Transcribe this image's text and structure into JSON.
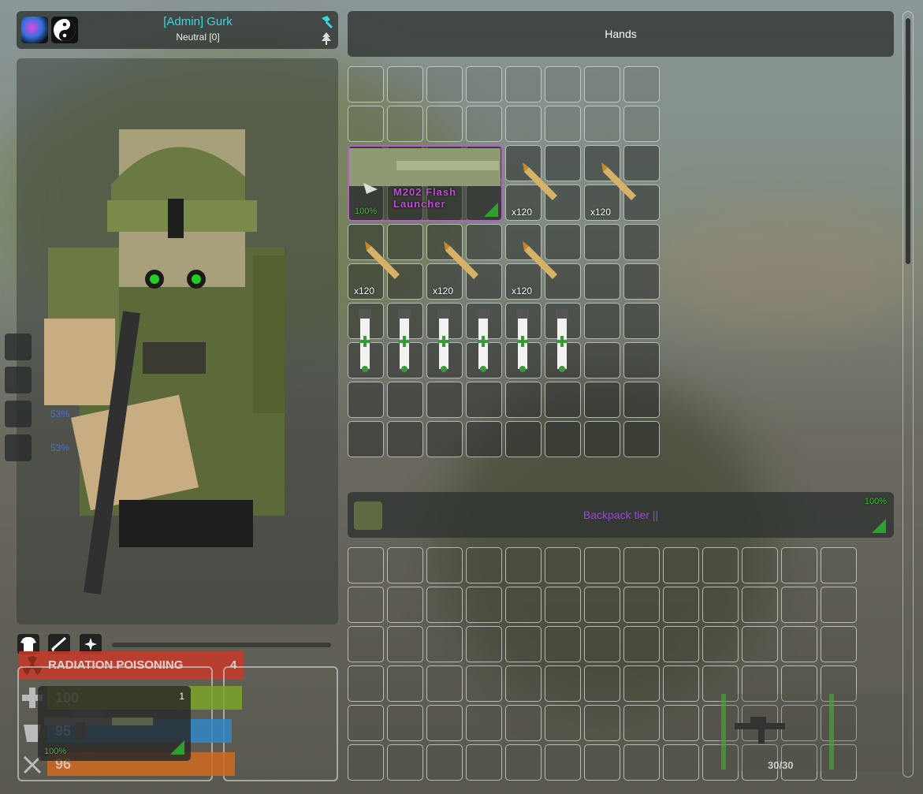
{
  "player": {
    "name": "[Admin] Gurk",
    "reputation": "Neutral [0]"
  },
  "hands": {
    "title": "Hands",
    "launcher": {
      "name": "M202 Flash Launcher",
      "quality": "100%"
    },
    "ammo_qty": "x120"
  },
  "backpack": {
    "name": "Backpack tier ||",
    "quality": "100%"
  },
  "armor_pcts": [
    "53%",
    "53%"
  ],
  "status": {
    "effect": "RADIATION POISONING",
    "effect_level": "4",
    "health": "100",
    "water": "95",
    "food": "96"
  },
  "weapon_slot": {
    "count": "1",
    "quality": "100%"
  },
  "ammo_counter": "30/30",
  "colors": {
    "admin_name": "#3fd4e0",
    "item_name": "#c04ad8",
    "backpack_name": "#a040e0",
    "quality_green": "#3ec23e",
    "radiation": "#c83a2a",
    "health": "#7da22a",
    "water": "#2f87c8",
    "food": "#d06a1e"
  }
}
